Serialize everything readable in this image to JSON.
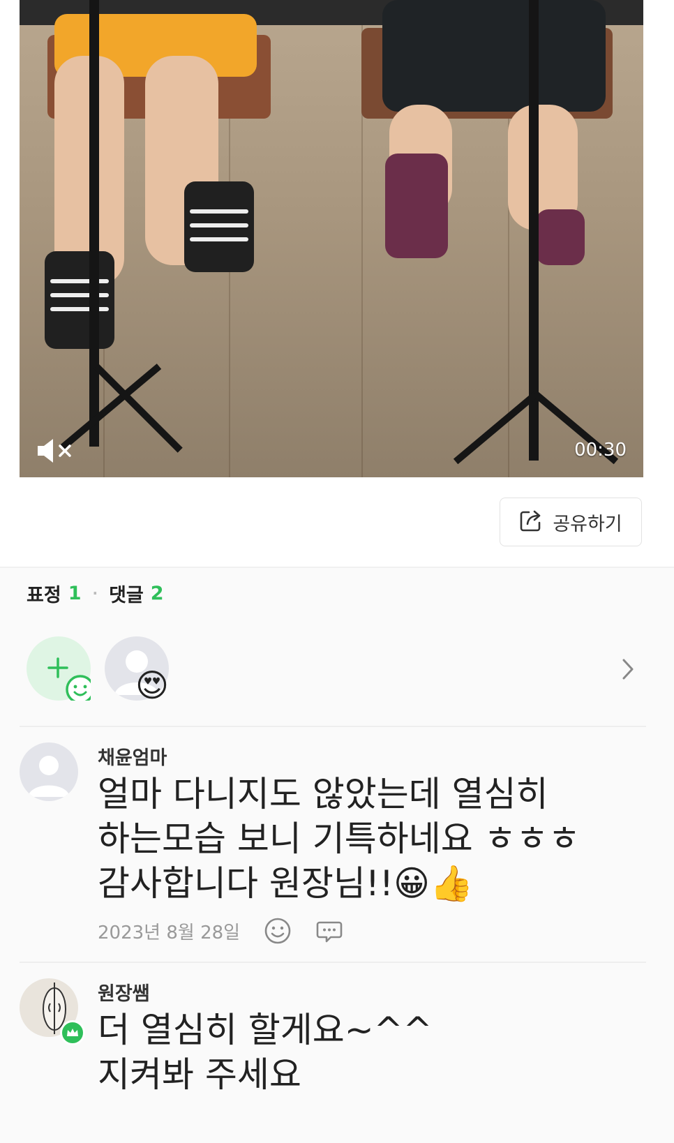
{
  "video": {
    "duration": "00:30",
    "mute_icon": "speaker-muted-icon"
  },
  "share": {
    "label": "공유하기",
    "icon": "share-icon"
  },
  "counts": {
    "reactions_label": "표정",
    "reactions_count": "1",
    "separator": "·",
    "comments_label": "댓글",
    "comments_count": "2"
  },
  "reactions": {
    "add_icon": "add-reaction-icon",
    "items": [
      {
        "emoji": "😍"
      }
    ],
    "more_icon": "chevron-right-icon"
  },
  "comments": [
    {
      "author": "채윤엄마",
      "text": "얼마 다니지도 않았는데 열심히\n하는모습 보니 기특하네요 ㅎㅎㅎ\n감사합니다 원장님!!😀👍",
      "date": "2023년 8월 28일",
      "emoji_icon": "smiley-icon",
      "reply_icon": "reply-bubble-icon"
    },
    {
      "author": "원장쌤",
      "text": "더 열심히 할게요~^^\n지켜봐 주세요",
      "badge_icon": "crown-icon"
    }
  ],
  "colors": {
    "accent": "#2fbf5a",
    "muted": "#999999"
  }
}
